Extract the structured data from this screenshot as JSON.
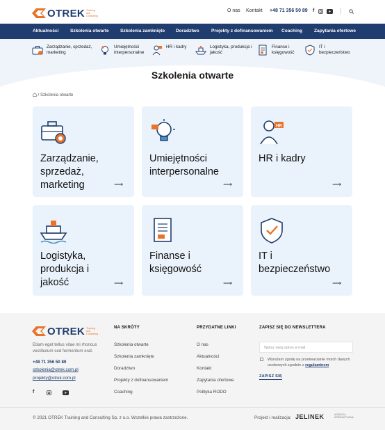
{
  "brand": {
    "name": "OTREK",
    "sub": "Training and Consulting",
    "accent": "#e8742c",
    "primary": "#1f3d6e"
  },
  "topnav": {
    "about": "O nas",
    "contact": "Kontakt",
    "phone": "+48 71 356 50 89"
  },
  "mainnav": [
    "Aktualności",
    "Szkolenia otwarte",
    "Szkolenia zamknięte",
    "Doradztwo",
    "Projekty z dofinansowaniem",
    "Coaching",
    "Zapytania ofertowe"
  ],
  "subnav": [
    {
      "label": "Zarządzanie, sprzedaż, marketing",
      "icon": "briefcase-icon"
    },
    {
      "label": "Umiejętności interpersonalne",
      "icon": "bulb-icon"
    },
    {
      "label": "HR i kadry",
      "icon": "person-icon"
    },
    {
      "label": "Logistyka, produkcja i jakość",
      "icon": "ship-icon"
    },
    {
      "label": "Finanse i księgowość",
      "icon": "document-icon"
    },
    {
      "label": "IT i bezpieczeństwo",
      "icon": "shield-icon"
    }
  ],
  "page": {
    "title": "Szkolenia otwarte",
    "breadcrumb": "/ Szkolenia otwarte"
  },
  "cards": [
    {
      "title": "Zarządzanie, sprzedaż, marketing",
      "icon": "briefcase-icon"
    },
    {
      "title": "Umiejętności interpersonalne",
      "icon": "bulb-icon"
    },
    {
      "title": "HR i kadry",
      "icon": "person-icon"
    },
    {
      "title": "Logistyka, produkcja i jakość",
      "icon": "ship-icon"
    },
    {
      "title": "Finanse i księgowość",
      "icon": "document-icon"
    },
    {
      "title": "IT i bezpieczeństwo",
      "icon": "shield-icon"
    }
  ],
  "footer": {
    "about_text": "Etiam eget tellus vitae mi rhoncus vestibulum sed fermentum erat.",
    "phone": "+48 71 356 50 89",
    "email1": "szkolenia@otrek.com.pl",
    "email2": "projekty@otrek.com.pl",
    "shortcuts_heading": "NA SKRÓTY",
    "shortcuts": [
      "Szkolenia otwarte",
      "Szkolenia zamknięte",
      "Doradztwo",
      "Projekty z dofinansowaniem",
      "Coaching"
    ],
    "links_heading": "PRZYDATNE LINKI",
    "links": [
      "O nas",
      "Aktualności",
      "Kontakt",
      "Zapytania ofertowe",
      "Polityka RODO"
    ],
    "newsletter_heading": "ZAPISZ SIĘ DO NEWSLETTERA",
    "email_placeholder": "Wpisz swój adres e-mail",
    "consent_text": "Wyrażam zgodę na przetwarzanie moich danych osobowych zgodnie z",
    "consent_link": "regulaminem",
    "subscribe_label": "ZAPISZ SIĘ",
    "copyright": "© 2021 OTREK Training and Consulting Sp. z o.o. Wszelkie prawa zastrzeżone.",
    "realization_label": "Projekt i realizacja:",
    "agency": "JELINEK",
    "agency_sub": "AGENCJA INTERAKTYWNA"
  }
}
